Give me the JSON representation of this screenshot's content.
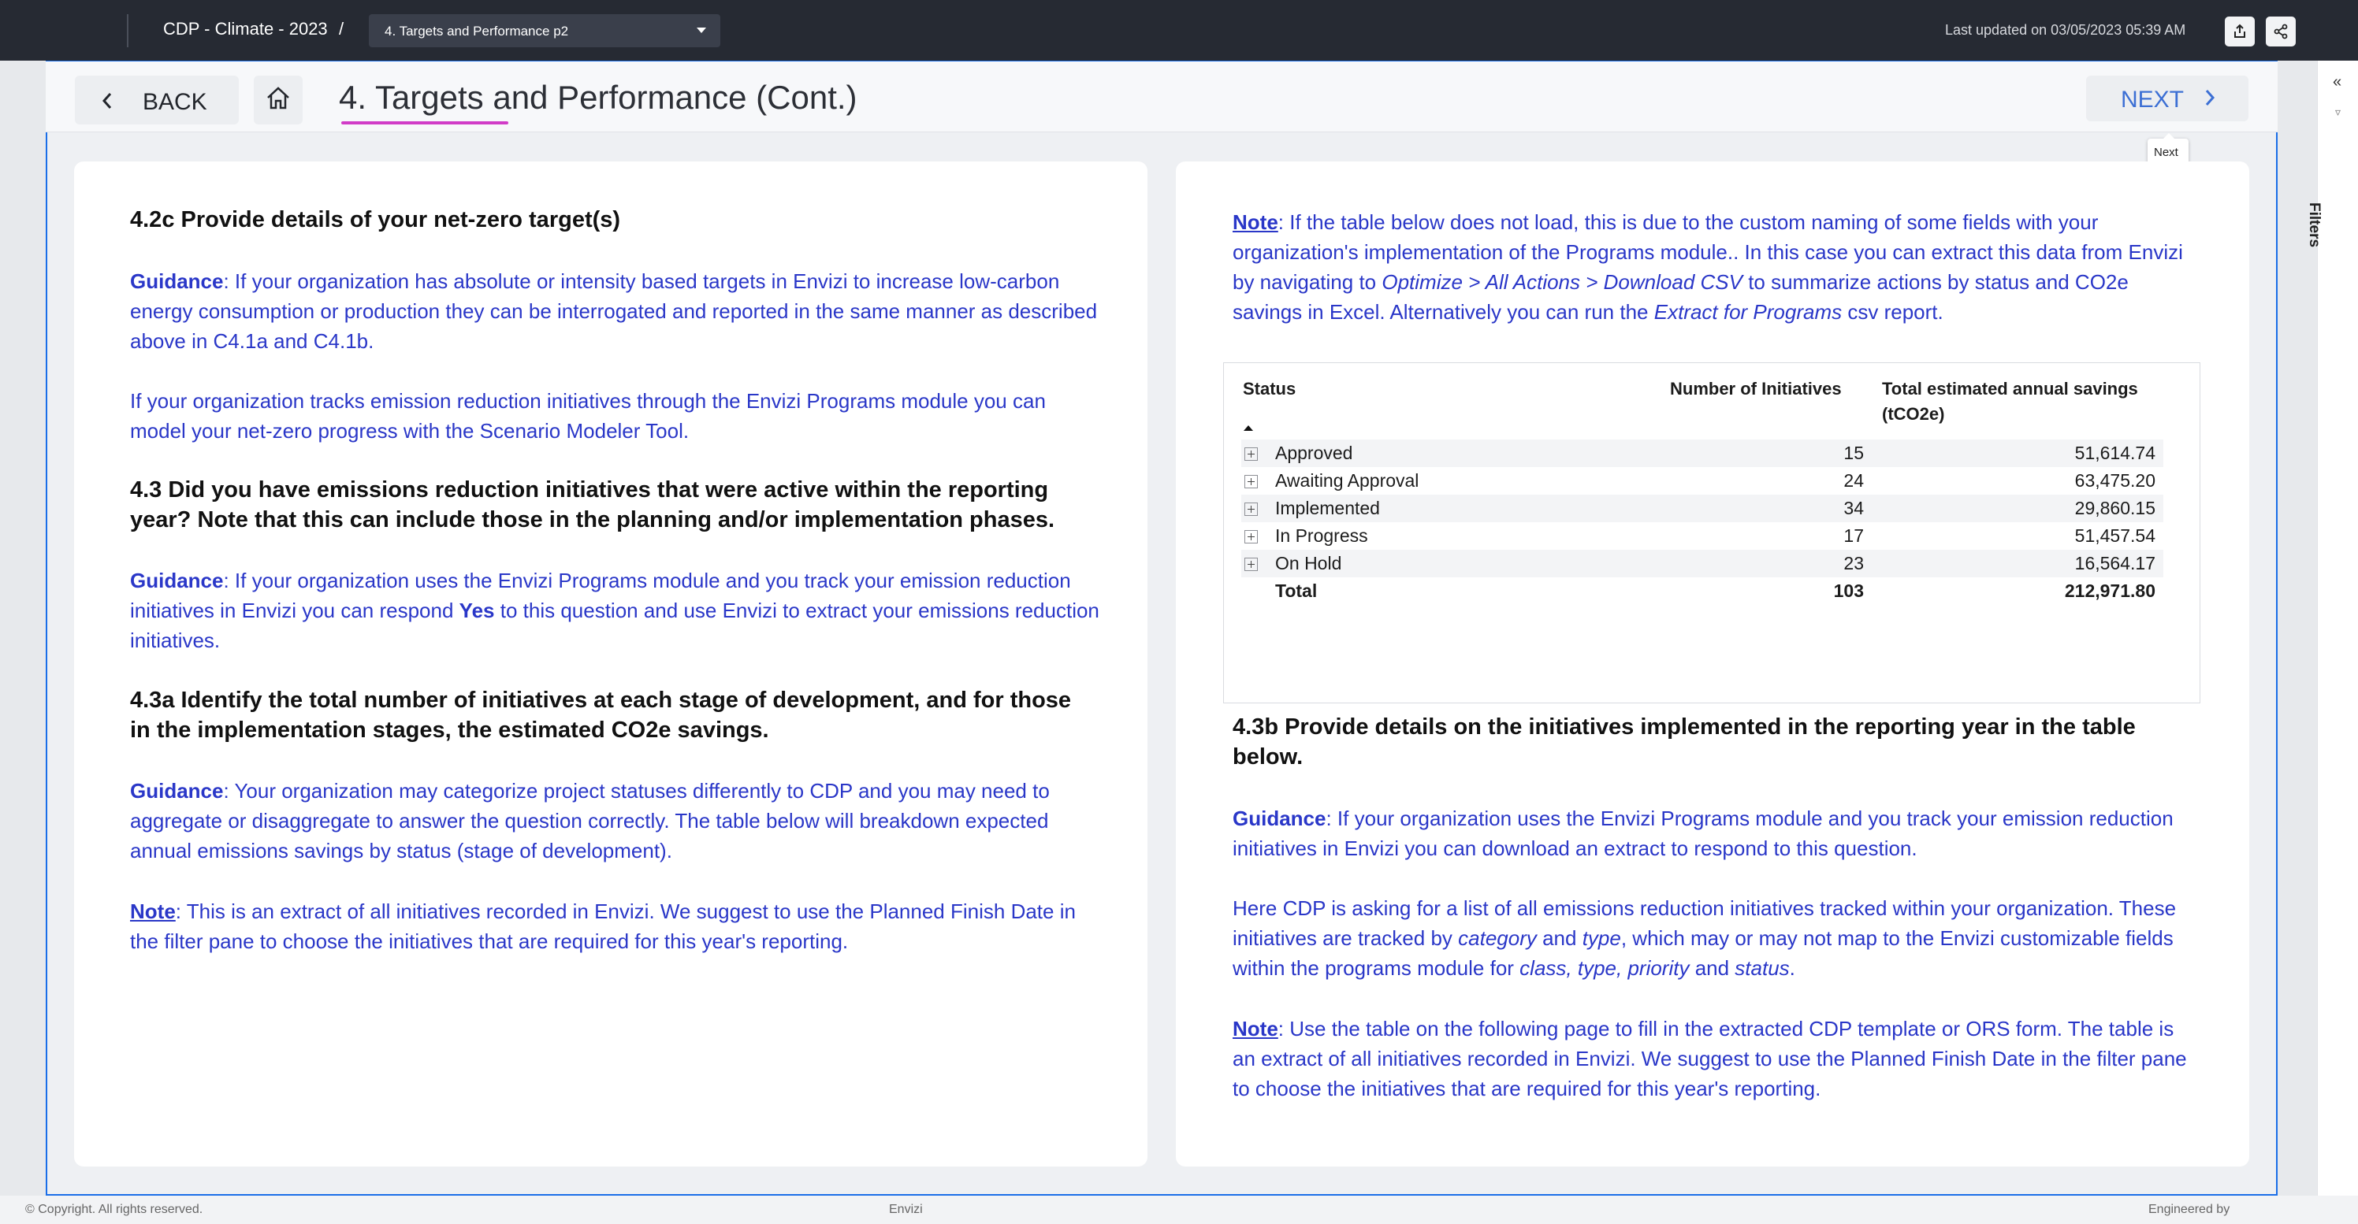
{
  "topbar": {
    "app_title": "CDP - Climate - 2023",
    "slash": "/",
    "page_select": "4. Targets and Performance p2",
    "last_updated": "Last updated on 03/05/2023 05:39 AM"
  },
  "header": {
    "back_label": "BACK",
    "title": "4. Targets and Performance (Cont.)",
    "next_label": "NEXT",
    "tooltip": "Next"
  },
  "filters": {
    "collapse": "«",
    "label": "Filters"
  },
  "left": {
    "h1": "4.2c Provide details of your net-zero target(s)",
    "g1_label": "Guidance",
    "g1_text": ": If your organization has absolute or intensity based targets in Envizi to increase low-carbon energy consumption or production they can be interrogated and reported in the same manner as described above in C4.1a and C4.1b.",
    "p1": "If your organization tracks emission reduction initiatives through the Envizi Programs module you can model your net-zero progress with the Scenario Modeler Tool.",
    "h2": "4.3 Did you have emissions reduction initiatives that were active within the reporting year? Note that this can include those in the planning and/or implementation phases.",
    "g2_label": "Guidance",
    "g2_a": ": If your organization uses the Envizi Programs module and you track your emission reduction initiatives in Envizi you can respond ",
    "g2_yes": "Yes",
    "g2_b": " to this question and use Envizi to extract your emissions reduction initiatives.",
    "h3": "4.3a Identify the total number of initiatives at each stage of development, and for those in the implementation stages, the estimated CO2e savings.",
    "g3_label": "Guidance",
    "g3_text": ": Your organization may categorize project statuses differently to CDP and you may need to aggregate or disaggregate to answer the question correctly. The table below will breakdown expected annual emissions savings by status (stage of development).",
    "n1_label": "Note",
    "n1_text": ": This is an extract of all initiatives recorded in Envizi. We suggest to use the Planned Finish Date in the filter pane to choose the initiatives that are required for this year's reporting."
  },
  "right": {
    "n1_label": "Note",
    "n1_a": ": If the table below does not load, this is due to the custom naming of some fields with your organization's implementation of the Programs module.. In this case you can extract this data from Envizi by navigating to ",
    "n1_path": "Optimize > All Actions > Download CSV",
    "n1_b": " to summarize actions by status and CO2e savings in Excel. Alternatively you can run the ",
    "n1_report": "Extract for Programs",
    "n1_c": " csv report.",
    "h1": "4.3b Provide details on the initiatives implemented in the reporting year in the table below.",
    "g1_label": "Guidance",
    "g1_text": ": If your organization uses the Envizi Programs module and you track your emission reduction initiatives in Envizi you can download an extract to respond to this question.",
    "p1_a": "Here CDP is asking for a list of all emissions reduction initiatives tracked within your organization. These initiatives are tracked by ",
    "p1_cat": "category",
    "p1_and1": " and ",
    "p1_type": "type",
    "p1_b": ", which may or may not map to the Envizi customizable fields within the programs module for ",
    "p1_list": "class, type, priority",
    "p1_and2": " and ",
    "p1_status": "status",
    "p1_end": ".",
    "n2_label": "Note",
    "n2_text": ": Use the table on the following page to fill in the extracted CDP template or ORS form. The table is an extract of all initiatives recorded in Envizi. We suggest to use the Planned Finish Date in the filter pane to choose the initiatives that are required for this year's reporting."
  },
  "table": {
    "col_status": "Status",
    "col_number": "Number of Initiatives",
    "col_savings": "Total estimated annual savings (tCO2e)",
    "rows": [
      {
        "status": "Approved",
        "number": "15",
        "savings": "51,614.74"
      },
      {
        "status": "Awaiting Approval",
        "number": "24",
        "savings": "63,475.20"
      },
      {
        "status": "Implemented",
        "number": "34",
        "savings": "29,860.15"
      },
      {
        "status": "In Progress",
        "number": "17",
        "savings": "51,457.54"
      },
      {
        "status": "On Hold",
        "number": "23",
        "savings": "16,564.17"
      }
    ],
    "total": {
      "status": "Total",
      "number": "103",
      "savings": "212,971.80"
    }
  },
  "footer": {
    "copyright": "© Copyright. All rights reserved.",
    "center": "Envizi",
    "right": "Engineered by"
  }
}
